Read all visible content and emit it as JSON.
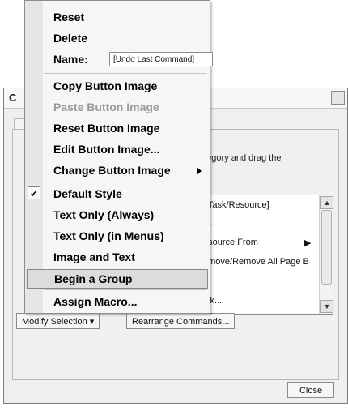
{
  "dialog": {
    "title_visible": "C",
    "close_glyph": "⊠",
    "hint_text": "ategory and drag the\n'.",
    "list_items": [
      ": Task/Resource]",
      "n...",
      "esource From",
      "emove/Remove All Page B",
      "...",
      "ink..."
    ],
    "modify_selection_label": "Modify Selection",
    "rearrange_label": "Rearrange Commands...",
    "close_button_label": "Close"
  },
  "menu": {
    "reset": "Reset",
    "delete": "Delete",
    "name_label": "Name:",
    "name_value": "[Undo Last Command]",
    "copy_button_image": "Copy Button Image",
    "paste_button_image": "Paste Button Image",
    "reset_button_image": "Reset Button Image",
    "edit_button_image": "Edit Button Image...",
    "change_button_image": "Change Button Image",
    "default_style": "Default Style",
    "text_only_always": "Text Only (Always)",
    "text_only_menus": "Text Only (in Menus)",
    "image_and_text": "Image and Text",
    "begin_group": "Begin a Group",
    "assign_macro": "Assign Macro..."
  },
  "icons": {
    "check": "✔",
    "submenu_arrow": "triangle-right",
    "scroll_up": "▲",
    "scroll_down": "▼",
    "list_arrow": "▶",
    "dropdown": "▾"
  }
}
